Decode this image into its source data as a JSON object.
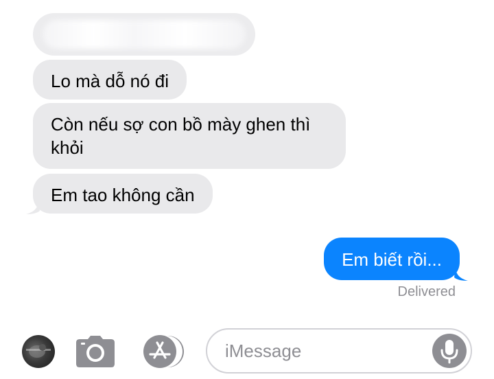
{
  "thread": {
    "incoming": [
      {
        "text": ""
      },
      {
        "text": "Lo mà dỗ nó đi"
      },
      {
        "text": "Còn nếu sợ con bồ mày ghen thì khỏi"
      },
      {
        "text": "Em tao không cần"
      }
    ],
    "outgoing": [
      {
        "text": "Em biết rồi..."
      }
    ],
    "status": "Delivered"
  },
  "composer": {
    "placeholder": "iMessage",
    "value": ""
  },
  "colors": {
    "incoming_bubble": "#e9e9eb",
    "outgoing_bubble": "#0b84fe",
    "status_text": "#8e8e93",
    "mic_button": "#8e8e93"
  },
  "icons": {
    "avatar": "contact-avatar",
    "camera": "camera-icon",
    "apps": "app-store-icon",
    "mic": "microphone-icon"
  }
}
